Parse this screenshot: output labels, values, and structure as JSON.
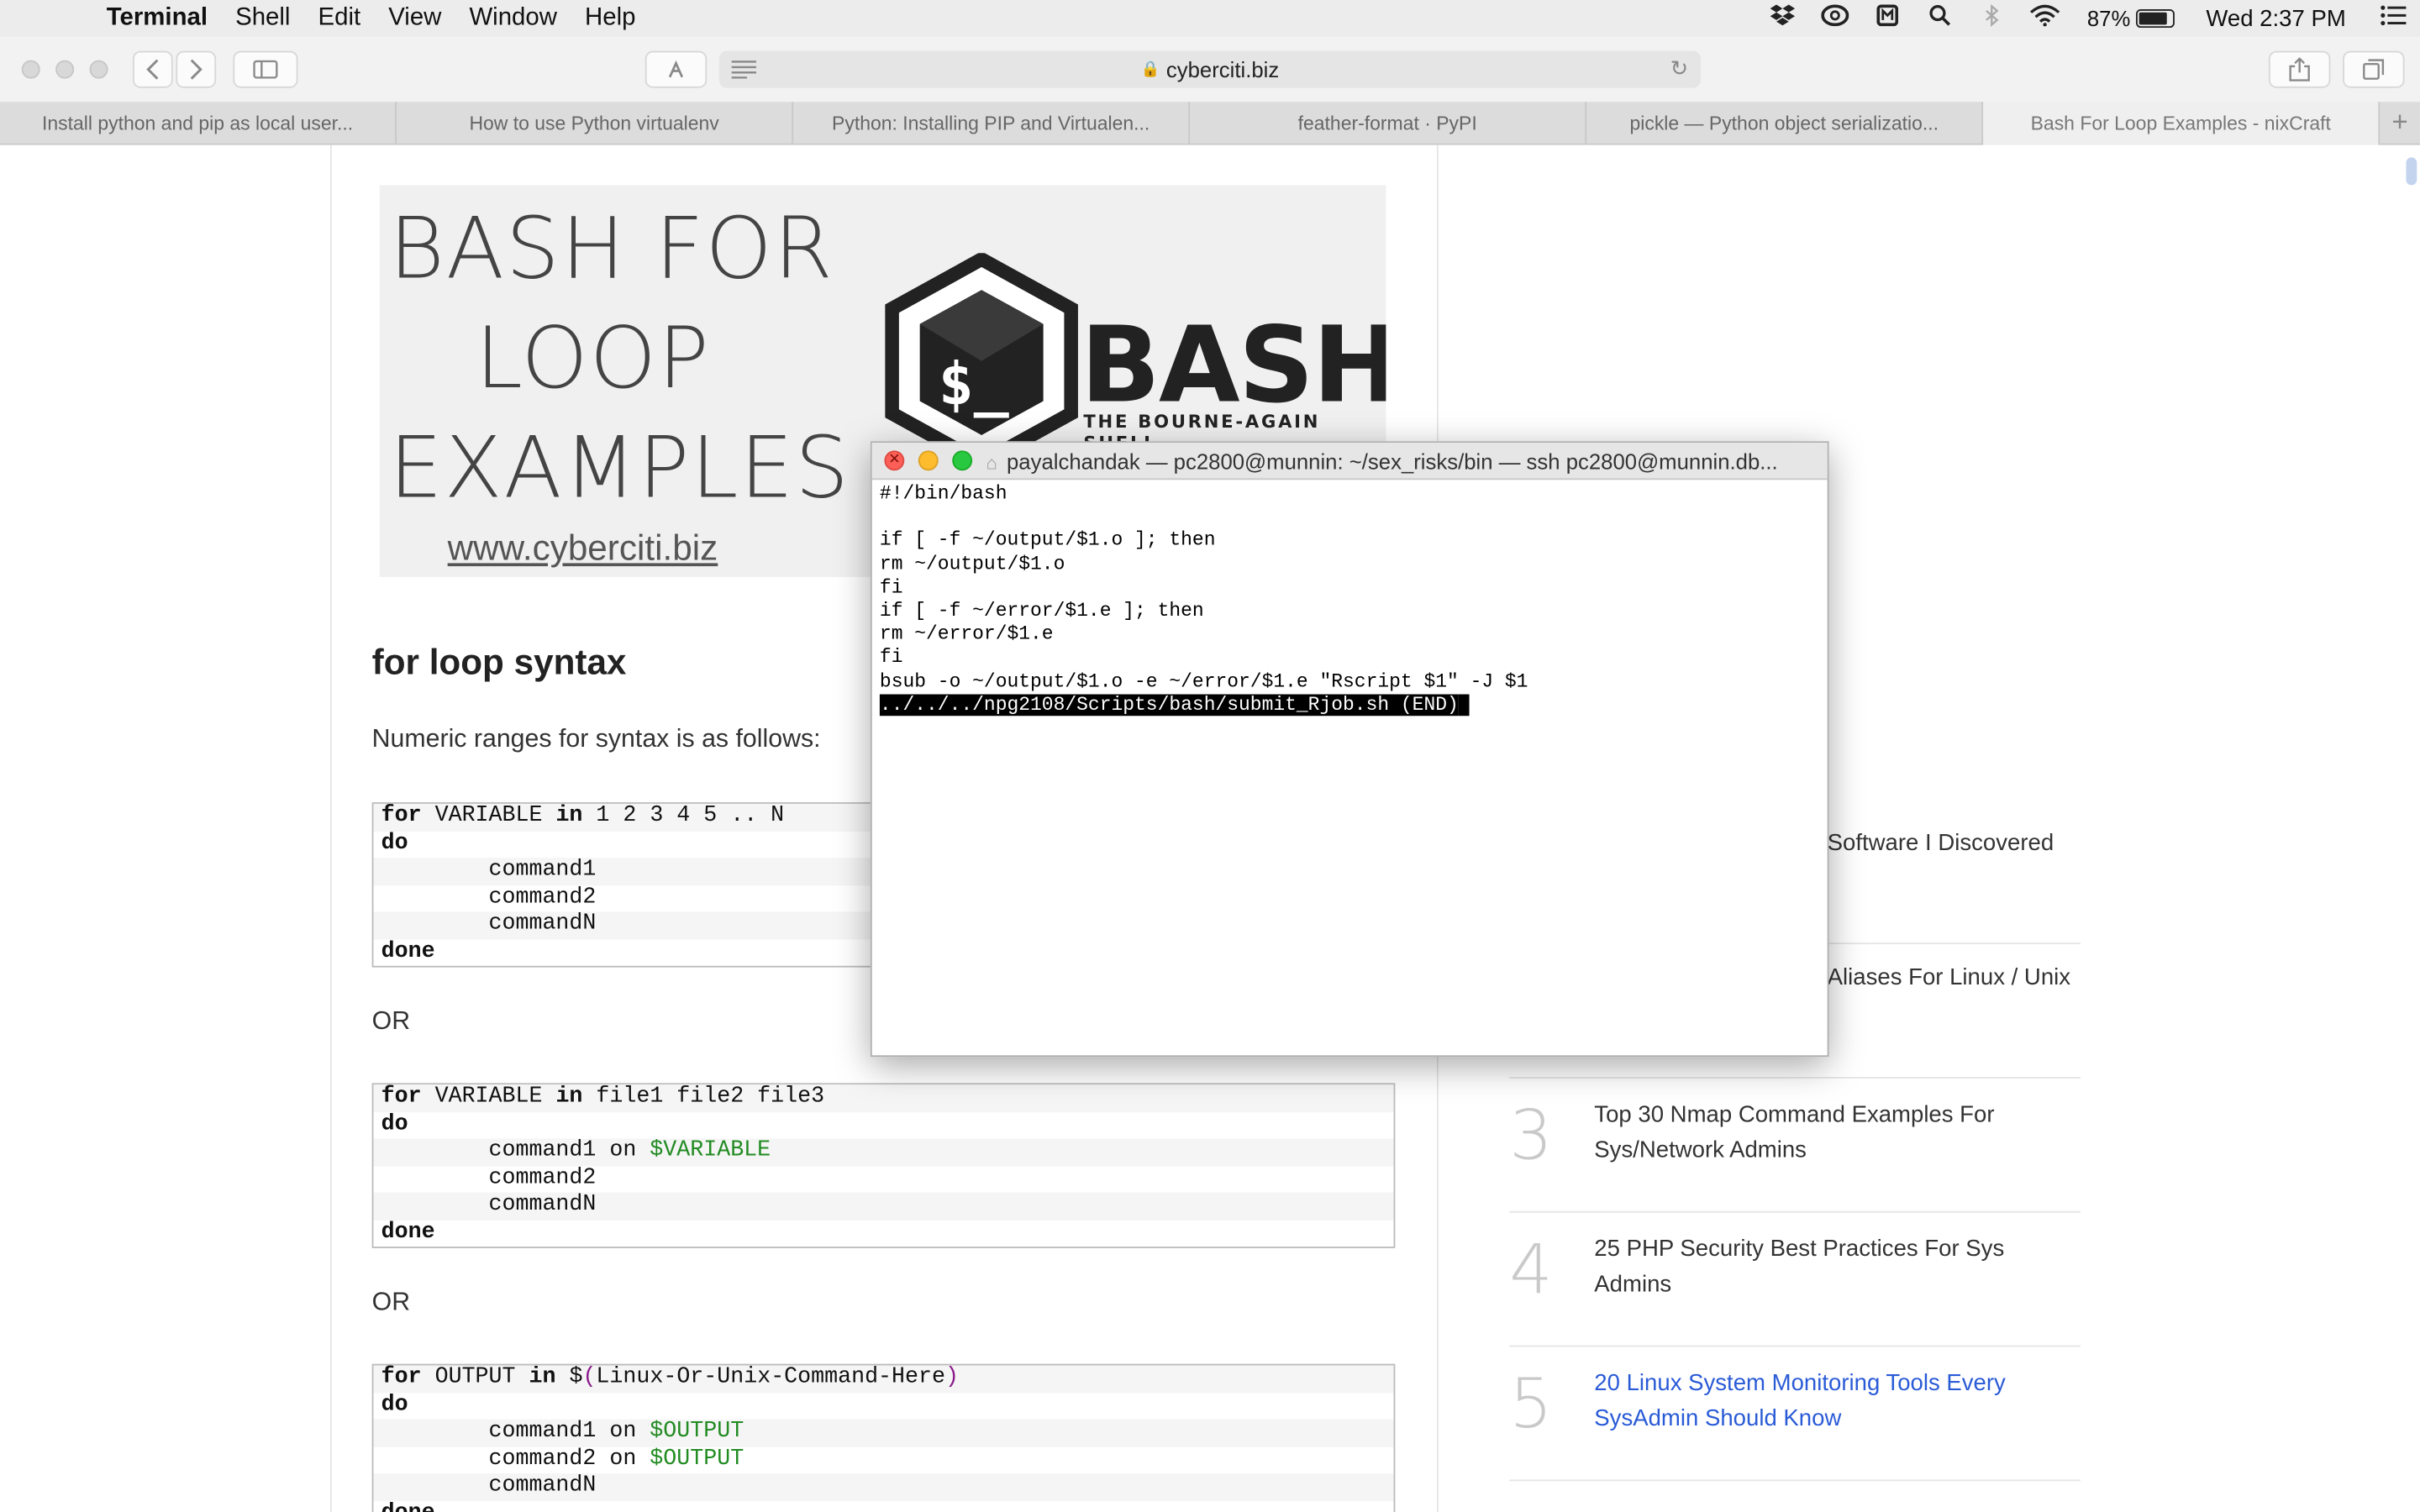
{
  "menubar": {
    "app_name": "Terminal",
    "items": [
      "Shell",
      "Edit",
      "View",
      "Window",
      "Help"
    ],
    "battery_percent": "87%",
    "battery_level": 0.87,
    "clock": "Wed 2:37 PM"
  },
  "toolbar": {
    "url": "cyberciti.biz"
  },
  "tabs": [
    "Install python and pip as local user...",
    "How to use Python virtualenv",
    "Python: Installing PIP and Virtualen...",
    "feather-format · PyPI",
    "pickle — Python object serializatio...",
    "Bash For Loop Examples - nixCraft"
  ],
  "tab_add": "+",
  "hero": {
    "lines": [
      "BASH FOR",
      "LOOP",
      "EXAMPLES"
    ],
    "site": "www.cyberciti.biz",
    "logo_word": "BASH",
    "logo_sub": "THE BOURNE-AGAIN SHELL",
    "logo_symbol": "$_"
  },
  "article": {
    "heading": "for loop syntax",
    "intro": "Numeric ranges for syntax is as follows:",
    "or_1": "OR",
    "or_2": "OR"
  },
  "code_blocks": {
    "block1": [
      "for VARIABLE in 1 2 3 4 5 .. N",
      "do",
      "        command1",
      "        command2",
      "        commandN",
      "done"
    ],
    "block2": [
      "for VARIABLE in file1 file2 file3",
      "do",
      "        command1 on $VARIABLE",
      "        command2",
      "        commandN",
      "done"
    ],
    "block3": [
      "for OUTPUT in $(Linux-Or-Unix-Command-Here)",
      "do",
      "        command1 on $OUTPUT",
      "        command2 on $OUTPUT",
      "        commandN",
      "done"
    ]
  },
  "sidebar": {
    "frag_colon": ":",
    "frag_1": "Software I Discovered",
    "frag_2": "Aliases For Linux / Unix",
    "items": [
      {
        "num": "3",
        "title": "Top 30 Nmap Command Examples For Sys/Network Admins"
      },
      {
        "num": "4",
        "title": "25 PHP Security Best Practices For Sys Admins"
      },
      {
        "num": "5",
        "title": "20 Linux System Monitoring Tools Every SysAdmin Should Know"
      }
    ]
  },
  "terminal": {
    "title": "payalchandak — pc2800@munnin: ~/sex_risks/bin — ssh pc2800@munnin.db...",
    "lines": [
      "#!/bin/bash",
      "",
      "if [ -f ~/output/$1.o ]; then",
      "rm ~/output/$1.o",
      "fi",
      "if [ -f ~/error/$1.e ]; then",
      "rm ~/error/$1.e",
      "fi",
      "bsub -o ~/output/$1.o -e ~/error/$1.e \"Rscript $1\" -J $1"
    ],
    "selected_line": "../../../npg2108/Scripts/bash/submit_Rjob.sh (END)"
  },
  "colors": {
    "link": "#2a5bd7",
    "code_var": "#228b22",
    "close": "#fc5f57",
    "minimize": "#fdbc2e",
    "maximize": "#28c840"
  }
}
